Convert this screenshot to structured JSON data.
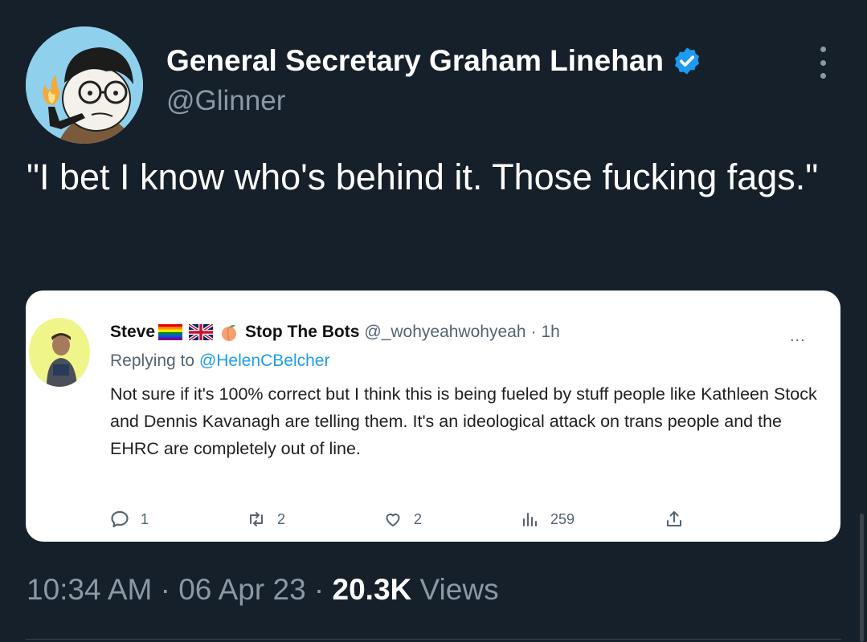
{
  "author": {
    "name": "General Secretary Graham Linehan",
    "handle": "@Glinner"
  },
  "tweet": {
    "text": "\"I bet I know who's behind it. Those fucking fags.\""
  },
  "quote": {
    "name": "Steve",
    "name_suffix": "Stop The Bots",
    "handle": "@_wohyeahwohyeah",
    "separator": "·",
    "time": "1h",
    "more": "...",
    "replying_prefix": "Replying to",
    "replying_to": "@HelenCBelcher",
    "body": "Not sure if it's 100% correct but I think this is being fueled by stuff people like Kathleen Stock and Dennis Kavanagh are telling them. It's an ideological attack on trans people and the EHRC are completely out of line.",
    "actions": {
      "replies": "1",
      "retweets": "2",
      "likes": "2",
      "views": "259"
    }
  },
  "meta": {
    "time": "10:34 AM",
    "sep1": "·",
    "date": "06 Apr 23",
    "sep2": "·",
    "views_count": "20.3K",
    "views_label": "Views"
  },
  "colors": {
    "background": "#15202b",
    "accent_blue": "#1d9bf0",
    "muted_text": "#8b98a5"
  },
  "icons": {
    "verified": "verified-badge-icon",
    "more": "more-vertical-icon",
    "reply": "reply-icon",
    "retweet": "retweet-icon",
    "like": "heart-icon",
    "views": "analytics-icon",
    "share": "share-icon",
    "pride_flag": "rainbow-flag-icon",
    "uk_flag": "uk-flag-icon",
    "peach": "peach-icon"
  }
}
